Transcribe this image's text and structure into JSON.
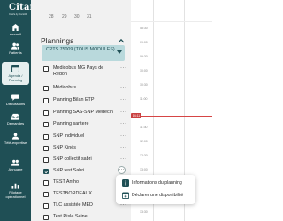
{
  "app": {
    "logo_text": "Citaña",
    "logo_subtitle": "Citaña by Doctolib"
  },
  "nav": {
    "items": [
      {
        "label": "Accueil"
      },
      {
        "label": "Patients"
      },
      {
        "label": "Agenda / Planning"
      },
      {
        "label": "Discussions"
      },
      {
        "label": "Demandes"
      },
      {
        "label": "Télé-expertise"
      },
      {
        "label": "Annuaire"
      },
      {
        "label": "Pilotage opérationnel"
      }
    ]
  },
  "daybar": {
    "days": [
      "28",
      "29",
      "30",
      "31"
    ]
  },
  "panel": {
    "title": "Plannings",
    "selected_group": "CPTS 75009 (TOUS MODULES)"
  },
  "plannings": [
    {
      "label": "Medicobus MG Pays de Redon",
      "checked": false
    },
    {
      "label": "Médicobus",
      "checked": false
    },
    {
      "label": "Planning Bilan ETP",
      "checked": false
    },
    {
      "label": "Planning SAS-SNP Médecin",
      "checked": false
    },
    {
      "label": "Planning santere",
      "checked": false
    },
    {
      "label": "SNP Individuel",
      "checked": false
    },
    {
      "label": "SNP Kinés",
      "checked": false
    },
    {
      "label": "SNP collectif sabri",
      "checked": false
    },
    {
      "label": "SNP test Sabri",
      "checked": true
    },
    {
      "label": "TEST Antho",
      "checked": false
    },
    {
      "label": "TESTBORDEAUX",
      "checked": false
    },
    {
      "label": "TLC assistée MED",
      "checked": false
    },
    {
      "label": "Test Risle Seine",
      "checked": false
    }
  ],
  "grid": {
    "times": [
      "08:30",
      "09:00",
      "09:30",
      "10:00",
      "10:30",
      "11:00",
      "11:30",
      "12:00",
      "12:30",
      "13:00",
      "13:30"
    ],
    "now_label": "14:11"
  },
  "popup": {
    "items": [
      {
        "label": "Informations du planning",
        "icon": "info-icon"
      },
      {
        "label": "Déclarer une disponibilité",
        "icon": "calendar-add-icon"
      }
    ]
  },
  "colors": {
    "nav_bg": "#1f4f55",
    "select_bg": "#b9d9dc",
    "now_red": "#c94040"
  }
}
